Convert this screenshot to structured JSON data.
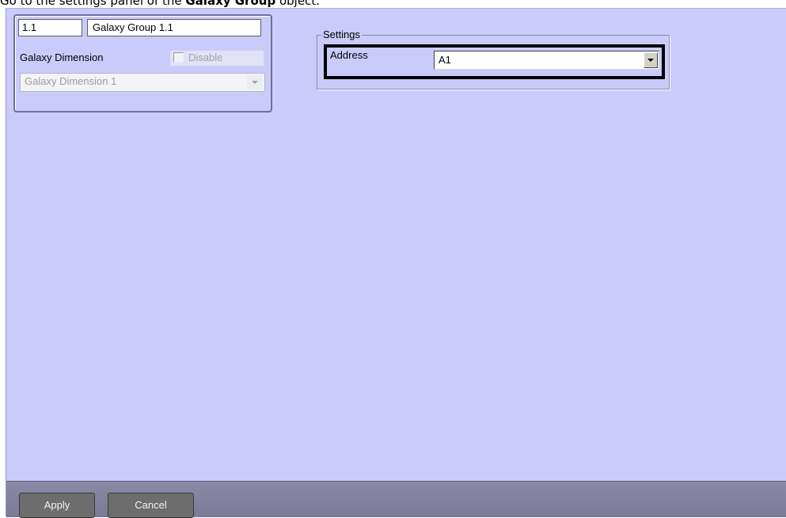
{
  "caption": {
    "prefix": "Go to the settings panel of the ",
    "bold": "Galaxy Group",
    "suffix": " object."
  },
  "object_header": {
    "id_value": "1.1",
    "name_value": "Galaxy Group 1.1",
    "parent_label": "Galaxy Dimension",
    "disable_label": "Disable",
    "disable_checked": false,
    "parent_selected": "Galaxy Dimension 1"
  },
  "settings": {
    "group_title": "Settings",
    "address_label": "Address",
    "address_selected": "A1"
  },
  "footer": {
    "apply_label": "Apply",
    "cancel_label": "Cancel"
  },
  "colors": {
    "panel_bg": "#cbcbfb",
    "footer_bg": "#7f7f9c",
    "button_bg": "#6d6d6d",
    "highlight": "#000000"
  }
}
